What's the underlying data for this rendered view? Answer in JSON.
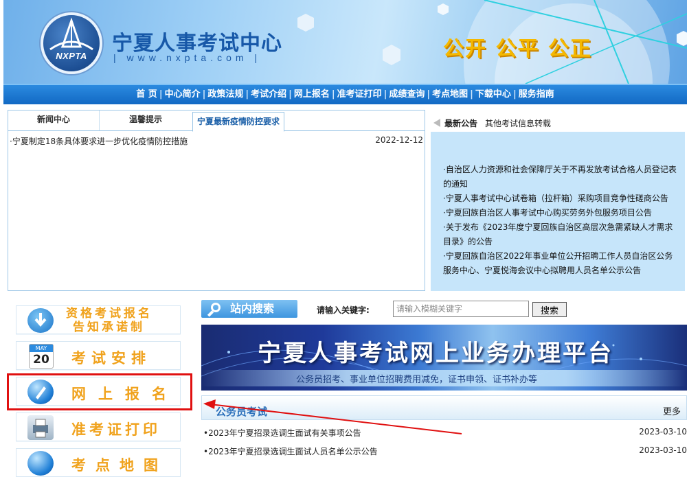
{
  "header": {
    "logo_text": "NXPTA",
    "site_name": "宁夏人事考试中心",
    "site_url": "| www.nxpta.com |",
    "slogan": "公开 公平 公正"
  },
  "nav": {
    "items": [
      "首 页",
      "中心简介",
      "政策法规",
      "考试介绍",
      "网上报名",
      "准考证打印",
      "成绩查询",
      "考点地图",
      "下载中心",
      "服务指南"
    ]
  },
  "news": {
    "tabs": [
      "新闻中心",
      "温馨提示",
      "宁夏最新疫情防控要求"
    ],
    "items": [
      {
        "title": "·宁夏制定18条具体要求进一步优化疫情防控措施",
        "date": "2022-12-12"
      }
    ]
  },
  "notice": {
    "tab_active": "最新公告",
    "tab_other": "其他考试信息转载",
    "items": [
      "·自治区人力资源和社会保障厅关于不再发放考试合格人员登记表的通知",
      "·宁夏人事考试中心试卷箱（拉杆箱）采购项目竞争性磋商公告",
      "·宁夏回族自治区人事考试中心购买劳务外包服务项目公告",
      "·关于发布《2023年度宁夏回族自治区高层次急需紧缺人才需求目录》的公告",
      "·宁夏回族自治区2022年事业单位公开招聘工作人员自治区公务服务中心、宁夏悦海会议中心拟聘用人员名单公示公告"
    ]
  },
  "left_buttons": {
    "qual_line1": "资格考试报名",
    "qual_line2": "告知承诺制",
    "calendar_month": "MAY",
    "calendar_day": "20",
    "schedule": "考试安排",
    "register": "网上报名",
    "admit_card": "准考证打印",
    "map": "考点地图"
  },
  "search": {
    "block_label": "站内搜索",
    "keyword_label": "请输入关键字:",
    "placeholder": "请输入模糊关键字",
    "button": "搜索"
  },
  "platform": {
    "title": "宁夏人事考试网上业务办理平台",
    "subtitle": "公务员招考、事业单位招聘费用减免，证书申领、证书补办等"
  },
  "exam": {
    "title": "公务员考试",
    "more": "更多",
    "items": [
      {
        "title": "•2023年宁夏招录选调生面试有关事项公告",
        "date": "2023-03-10"
      },
      {
        "title": "•2023年宁夏招录选调生面试人员名单公示公告",
        "date": "2023-03-10"
      }
    ]
  },
  "colors": {
    "nav_bg": "#1269c4",
    "accent_orange": "#f0a21c",
    "highlight_red": "#e01010",
    "notice_bg": "#c6e5fa"
  }
}
